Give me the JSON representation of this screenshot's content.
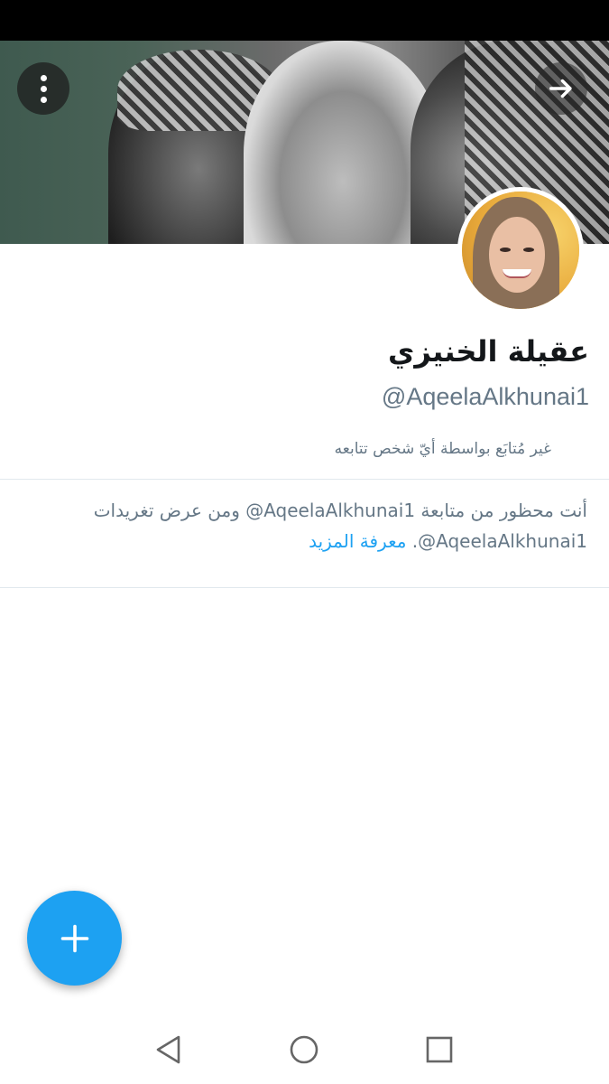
{
  "profile": {
    "display_name": "عقيلة الخنيزي",
    "handle": "@AqeelaAlkhunai1",
    "followed_by_text": "غير مُتابَع بواسطة أيّ شخص تتابعه"
  },
  "blocked_notice": {
    "line1": "أنت محظور من متابعة AqeelaAlkhunai1@ ومن عرض تغريدات",
    "line2_prefix": "AqeelaAlkhunai1@.",
    "learn_more": "معرفة المزيد"
  },
  "icons": {
    "more": "more-vertical-icon",
    "forward": "arrow-right-icon",
    "compose": "plus-icon",
    "nav_back": "triangle-back-icon",
    "nav_home": "circle-home-icon",
    "nav_recents": "square-recents-icon"
  },
  "colors": {
    "accent": "#1da1f2",
    "secondary_text": "#657786",
    "primary_text": "#14171a",
    "divider": "#e1e8ed"
  }
}
